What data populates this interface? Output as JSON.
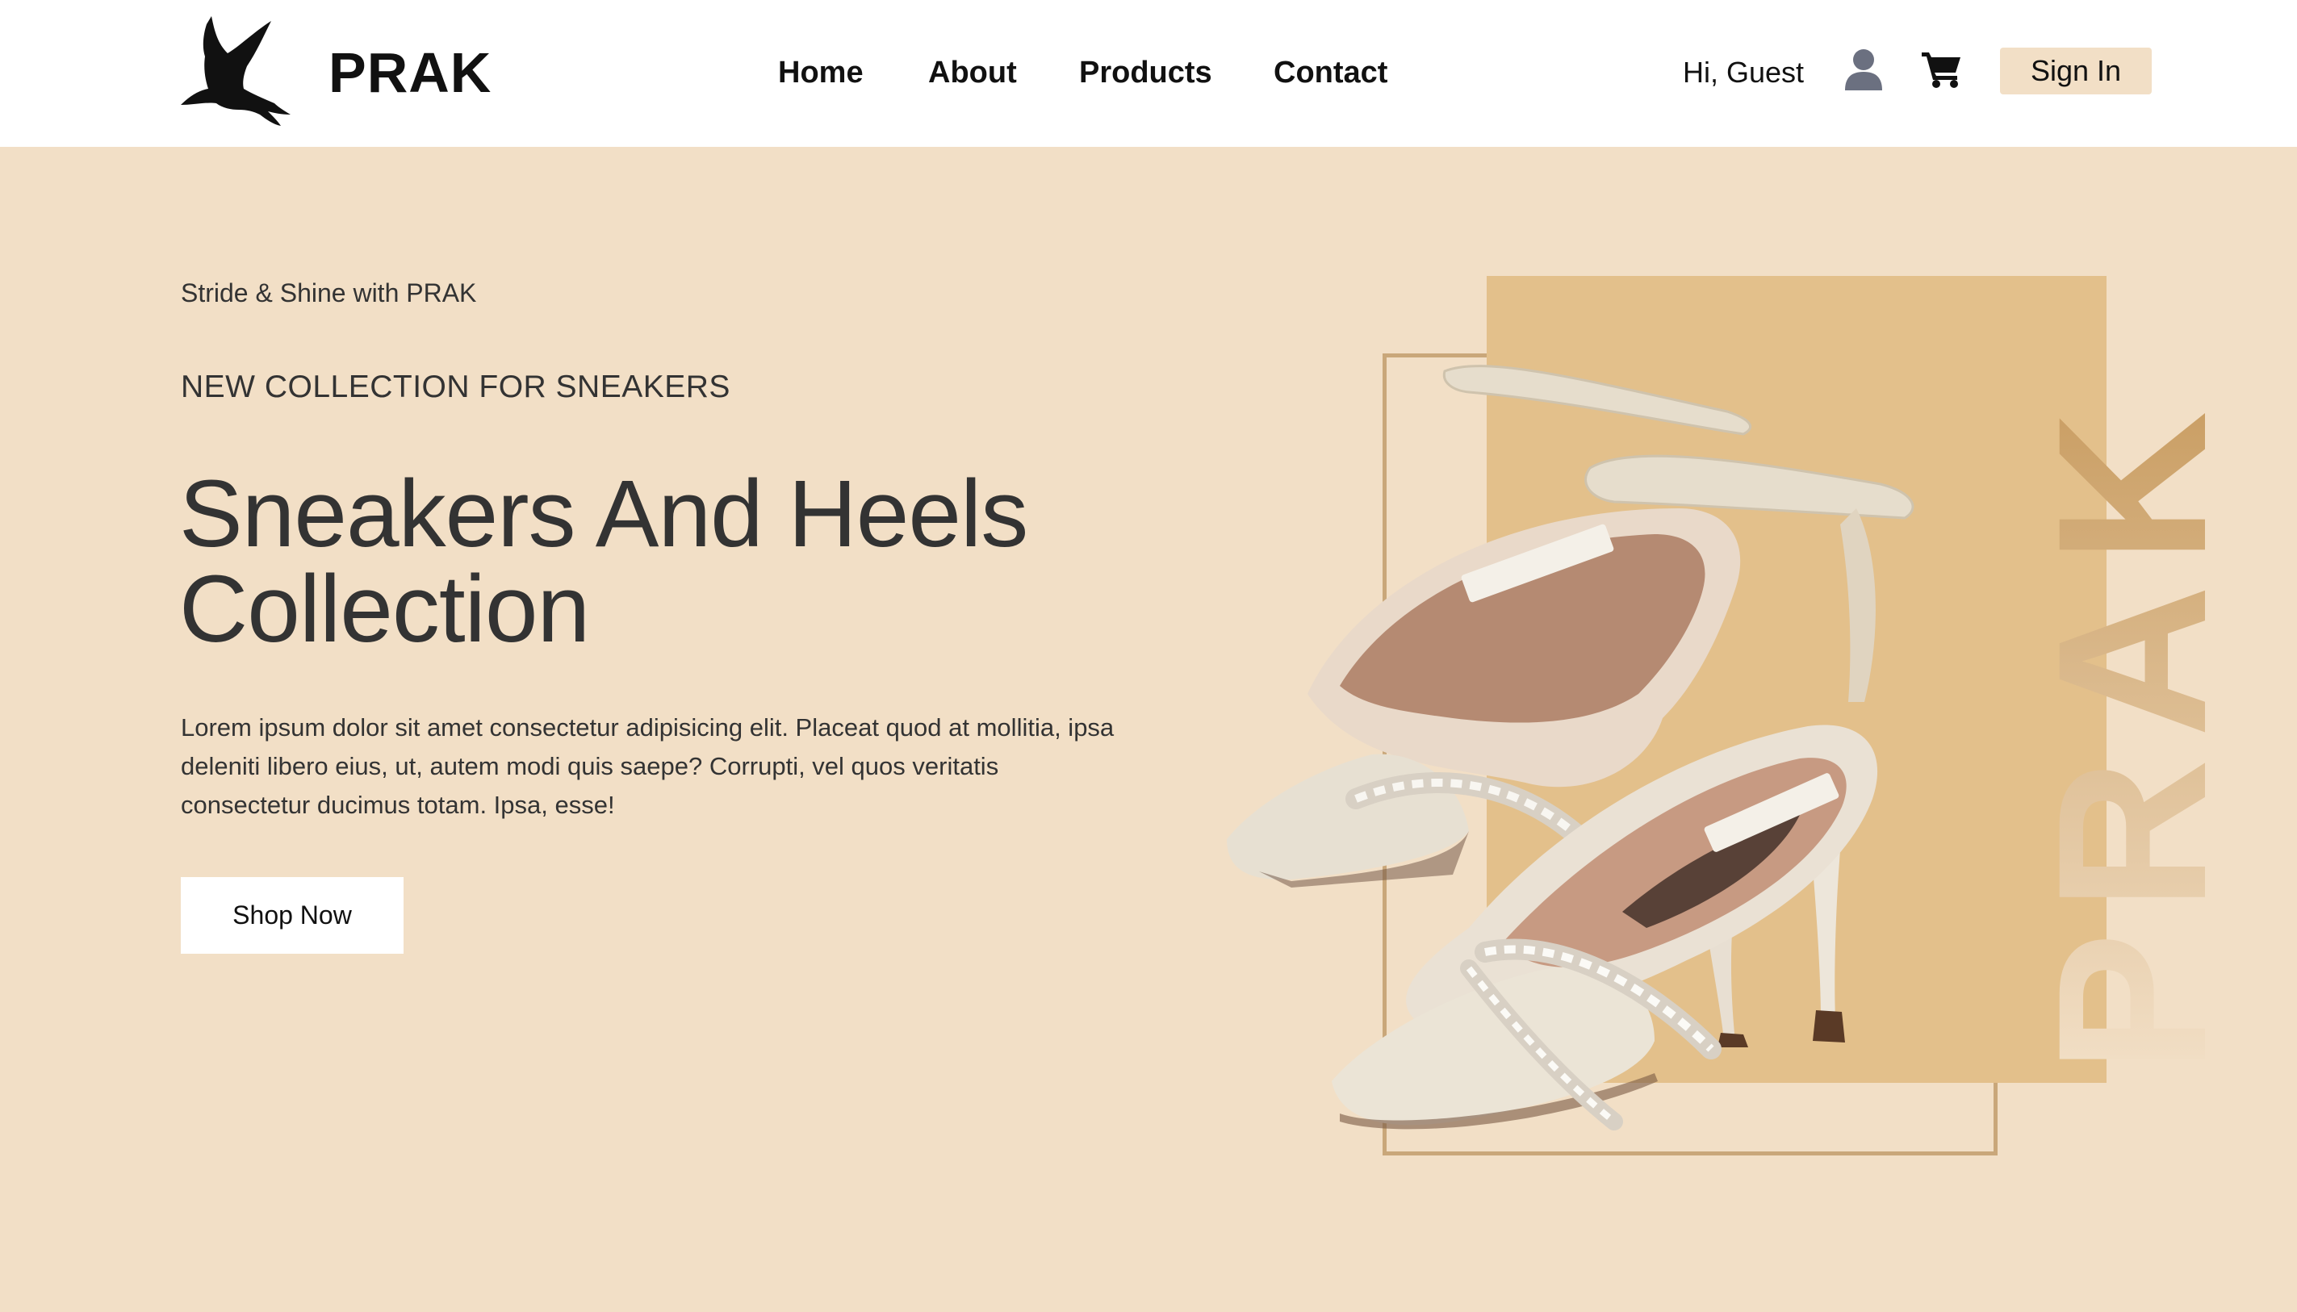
{
  "brand": {
    "name": "PRAK",
    "logo_icon": "bird-icon"
  },
  "nav": {
    "items": [
      {
        "label": "Home"
      },
      {
        "label": "About"
      },
      {
        "label": "Products"
      },
      {
        "label": "Contact"
      }
    ]
  },
  "account": {
    "greeting": "Hi, Guest",
    "user_icon": "user-icon",
    "cart_icon": "cart-icon",
    "signin_label": "Sign In"
  },
  "hero": {
    "eyebrow": "Stride & Shine with PRAK",
    "subheading": "NEW COLLECTION FOR SNEAKERS",
    "title_line1": "Sneakers And Heels",
    "title_line2": "Collection",
    "body": "Lorem ipsum dolor sit amet consectetur adipisicing elit. Placeat quod at mollitia, ipsa deleniti libero eius, ut, autem modi quis saepe? Corrupti, vel quos veritatis consectetur ducimus totam. Ipsa, esse!",
    "cta_label": "Shop Now",
    "watermark": "PRAK",
    "image": "high-heel-shoes-image"
  },
  "colors": {
    "background": "#f2dfc6",
    "accent_block": "#e3c08b",
    "frame": "#c9a77a",
    "header": "#ffffff",
    "text": "#333333"
  }
}
